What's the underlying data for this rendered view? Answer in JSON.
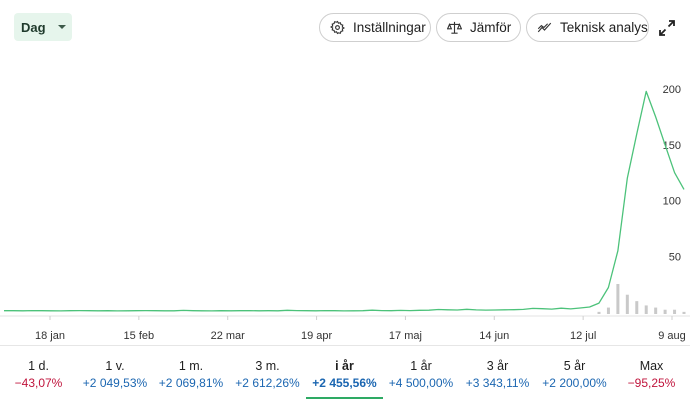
{
  "toolbar": {
    "interval": "Dag",
    "settings_label": "Inställningar",
    "compare_label": "Jämför",
    "technical_label": "Teknisk analys",
    "icons": [
      "gear-icon",
      "scale-icon",
      "trend-line-icon",
      "expand-icon"
    ]
  },
  "chart_data": {
    "type": "line",
    "x_ticks": [
      "18 jan",
      "15 feb",
      "22 mar",
      "19 apr",
      "17 maj",
      "14 jun",
      "12 jul",
      "9 aug"
    ],
    "y_ticks": [
      50,
      100,
      150,
      200
    ],
    "ylim": [
      0,
      210
    ],
    "line_color": "#4cc27a",
    "series": [
      {
        "values": [
          1.2,
          1.2,
          1.1,
          1.3,
          1.2,
          1.1,
          1.0,
          1.2,
          1.3,
          1.2,
          1.1,
          1.2,
          1.0,
          1.1,
          1.2,
          1.3,
          1.2,
          1.1,
          1.1,
          1.4,
          1.2,
          1.1,
          1.0,
          1.2,
          1.1,
          1.2,
          1.3,
          1.1,
          1.2,
          1.1,
          1.5,
          1.3,
          1.2,
          1.1,
          1.3,
          1.2,
          1.0,
          1.1,
          1.2,
          1.6,
          1.3,
          1.2,
          1.4,
          1.3,
          1.5,
          1.6,
          2.2,
          2.0,
          1.8,
          2.4,
          1.9,
          1.7,
          1.8,
          2.0,
          2.1,
          2.3,
          3.2,
          3.0,
          2.6,
          3.4,
          2.8,
          3.6,
          4.5,
          8.0,
          22.0,
          55.0,
          120.0,
          160.0,
          198.0,
          175.0,
          150.0,
          125.0,
          110.0
        ]
      }
    ],
    "volume": [
      0,
      0,
      0,
      0,
      0,
      0,
      0,
      0,
      0,
      0,
      0,
      0,
      0,
      0,
      0,
      0,
      0,
      0,
      0,
      0,
      0,
      0,
      0,
      0,
      0,
      0,
      0,
      0,
      0,
      0,
      0,
      0,
      0,
      0,
      0,
      0,
      0,
      0,
      0,
      0,
      0,
      0,
      0,
      0,
      0,
      0,
      0,
      0,
      0,
      0,
      0,
      0,
      0,
      0,
      0,
      0,
      0,
      0,
      0,
      0,
      0,
      0,
      0,
      1,
      3,
      14,
      9,
      6,
      4,
      3,
      2,
      2,
      1
    ]
  },
  "periods": [
    {
      "label": "1 d.",
      "change": "−43,07%",
      "sign": "neg"
    },
    {
      "label": "1 v.",
      "change": "+2 049,53%",
      "sign": "pos"
    },
    {
      "label": "1 m.",
      "change": "+2 069,81%",
      "sign": "pos"
    },
    {
      "label": "3 m.",
      "change": "+2 612,26%",
      "sign": "pos"
    },
    {
      "label": "i år",
      "change": "+2 455,56%",
      "sign": "pos",
      "active": true
    },
    {
      "label": "1 år",
      "change": "+4 500,00%",
      "sign": "pos"
    },
    {
      "label": "3 år",
      "change": "+3 343,11%",
      "sign": "pos"
    },
    {
      "label": "5 år",
      "change": "+2 200,00%",
      "sign": "pos"
    },
    {
      "label": "Max",
      "change": "−95,25%",
      "sign": "neg"
    }
  ]
}
